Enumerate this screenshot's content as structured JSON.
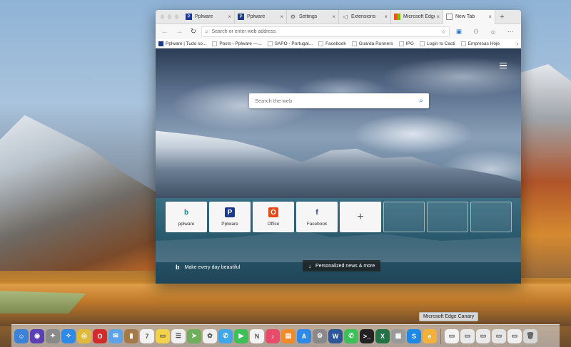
{
  "browser": {
    "tabs": [
      {
        "label": "Pplware",
        "icon": "pplware-icon",
        "active": false
      },
      {
        "label": "Pplware",
        "icon": "pplware-icon",
        "active": false
      },
      {
        "label": "Settings",
        "icon": "gear-icon",
        "active": false
      },
      {
        "label": "Extensions",
        "icon": "puzzle-icon",
        "active": false
      },
      {
        "label": "Microsoft Edge",
        "icon": "microsoft-icon",
        "active": false
      },
      {
        "label": "New Tab",
        "icon": "newtab-icon",
        "active": true
      }
    ],
    "new_tab_symbol": "+",
    "address": {
      "placeholder": "Search or enter web address"
    },
    "favorites": [
      {
        "label": "Pplware | Tudo so..."
      },
      {
        "label": "Posts ‹ Pplware —..."
      },
      {
        "label": "SAPO - Portugal..."
      },
      {
        "label": "Facebook"
      },
      {
        "label": "Guarda Runners"
      },
      {
        "label": "IPG"
      },
      {
        "label": "Login to Cacti"
      },
      {
        "label": "Empresas Hoje"
      }
    ],
    "favorites_more": "›"
  },
  "newtab": {
    "search_placeholder": "Search the web",
    "tiles": [
      {
        "label": "pplware",
        "logo": "b",
        "color": "#00897b"
      },
      {
        "label": "Pplware",
        "logo": "P",
        "color": "#1d3a8a"
      },
      {
        "label": "Office",
        "logo": "O",
        "color": "#e64a19"
      },
      {
        "label": "Facebook",
        "logo": "f",
        "color": "#1d3a8a"
      }
    ],
    "add_tile_symbol": "+",
    "empty_tiles": 3,
    "brand_text": "Make every day beautiful",
    "brand_icon": "b",
    "news_button": "Personalized news & more",
    "news_icon": "↓"
  },
  "dock": {
    "tooltip": "Microsoft Edge Canary",
    "apps": [
      {
        "name": "finder",
        "color": "#3b82d6",
        "glyph": "☺"
      },
      {
        "name": "siri",
        "color": "#5b3fb5",
        "glyph": "◉"
      },
      {
        "name": "launchpad",
        "color": "#8a8a8a",
        "glyph": "✦"
      },
      {
        "name": "safari",
        "color": "#2e8ae6",
        "glyph": "✧"
      },
      {
        "name": "chrome",
        "color": "#e0b93a",
        "glyph": "◎"
      },
      {
        "name": "opera",
        "color": "#d12b2b",
        "glyph": "O"
      },
      {
        "name": "mail",
        "color": "#5ea3e6",
        "glyph": "✉"
      },
      {
        "name": "notes-book",
        "color": "#a57a4a",
        "glyph": "▮"
      },
      {
        "name": "calendar",
        "color": "#f2f2f2",
        "glyph": "7"
      },
      {
        "name": "stickies",
        "color": "#f2d24a",
        "glyph": "▭"
      },
      {
        "name": "reminders",
        "color": "#f0f0f0",
        "glyph": "☰"
      },
      {
        "name": "maps",
        "color": "#6fae5a",
        "glyph": "➤"
      },
      {
        "name": "photos",
        "color": "#f0f0f0",
        "glyph": "✿"
      },
      {
        "name": "messages",
        "color": "#3fa7e8",
        "glyph": "✆"
      },
      {
        "name": "facetime",
        "color": "#3fbf5a",
        "glyph": "▶"
      },
      {
        "name": "news",
        "color": "#f2f2f2",
        "glyph": "N"
      },
      {
        "name": "music",
        "color": "#e84a6a",
        "glyph": "♪"
      },
      {
        "name": "books",
        "color": "#f08a2a",
        "glyph": "▤"
      },
      {
        "name": "app-store",
        "color": "#2e8ae6",
        "glyph": "A"
      },
      {
        "name": "system-preferences",
        "color": "#8a8a8a",
        "glyph": "⚙"
      },
      {
        "name": "word",
        "color": "#2b579a",
        "glyph": "W"
      },
      {
        "name": "whatsapp",
        "color": "#3fbf5a",
        "glyph": "✆"
      },
      {
        "name": "terminal",
        "color": "#222222",
        "glyph": ">_"
      },
      {
        "name": "excel",
        "color": "#217346",
        "glyph": "X"
      },
      {
        "name": "utility",
        "color": "#9a9a9a",
        "glyph": "▦"
      },
      {
        "name": "s-app",
        "color": "#1e88e5",
        "glyph": "S"
      },
      {
        "name": "edge-canary",
        "color": "#f2b13a",
        "glyph": "e"
      },
      {
        "name": "separator",
        "color": "",
        "glyph": ""
      },
      {
        "name": "doc-1",
        "color": "#f3f3f3",
        "glyph": "▭"
      },
      {
        "name": "doc-2",
        "color": "#e9e9e9",
        "glyph": "▭"
      },
      {
        "name": "doc-3",
        "color": "#eaeaea",
        "glyph": "▭"
      },
      {
        "name": "doc-4",
        "color": "#e5e5e5",
        "glyph": "▭"
      },
      {
        "name": "doc-5",
        "color": "#efefef",
        "glyph": "▭"
      },
      {
        "name": "trash",
        "color": "#d8d8d8",
        "glyph": "🗑"
      }
    ]
  }
}
